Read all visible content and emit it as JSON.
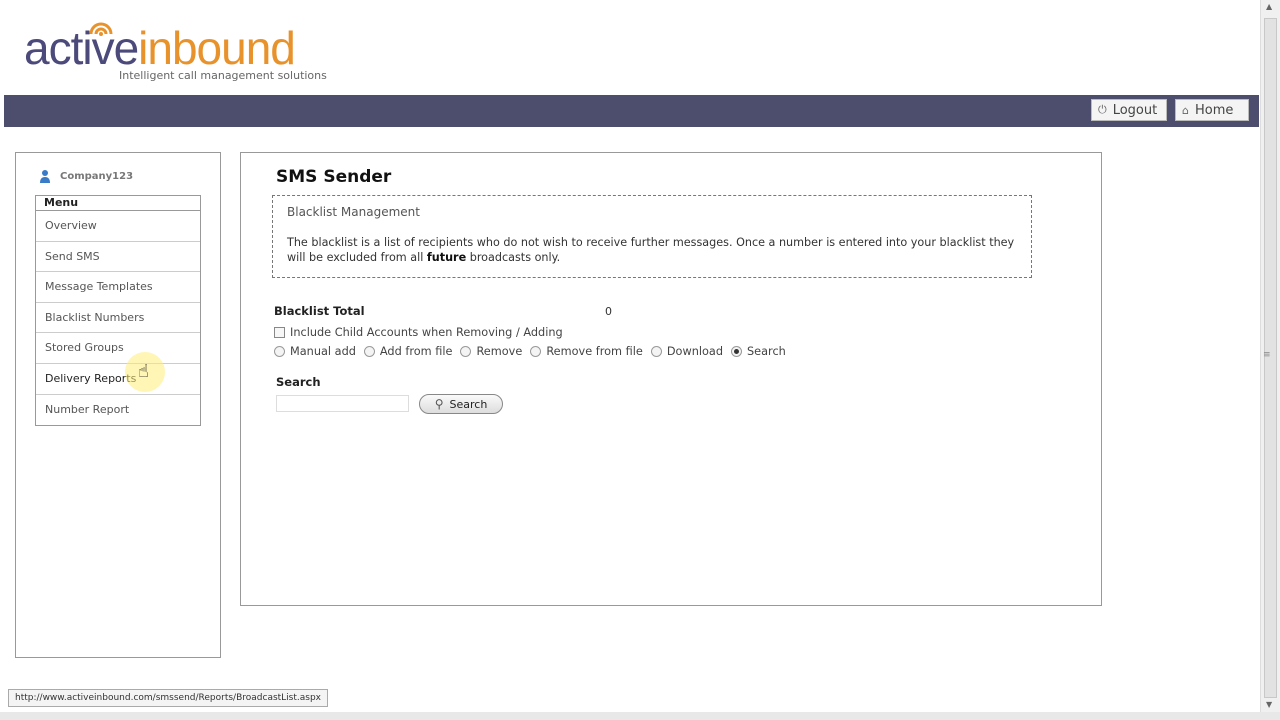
{
  "brand": {
    "name_part1": "active",
    "name_part2": "inbound",
    "tagline": "Intelligent call management solutions"
  },
  "topbar": {
    "logout_label": "Logout",
    "home_label": "Home"
  },
  "sidebar": {
    "username": "Company123",
    "menu_title": "Menu",
    "items": [
      {
        "label": "Overview"
      },
      {
        "label": "Send SMS"
      },
      {
        "label": "Message Templates"
      },
      {
        "label": "Blacklist Numbers"
      },
      {
        "label": "Stored Groups"
      },
      {
        "label": "Delivery Reports"
      },
      {
        "label": "Number Report"
      }
    ]
  },
  "main": {
    "title": "SMS Sender",
    "info": {
      "title": "Blacklist Management",
      "text_before": "The blacklist is a list of recipients who do not wish to receive further messages. Once a number is entered into your blacklist they will be excluded from all ",
      "text_bold": "future",
      "text_after": " broadcasts only."
    },
    "blacklist_total_label": "Blacklist Total",
    "blacklist_total_value": "0",
    "include_child_label": "Include Child Accounts when Removing / Adding",
    "include_child_checked": false,
    "modes": [
      {
        "label": "Manual add",
        "selected": false
      },
      {
        "label": "Add from file",
        "selected": false
      },
      {
        "label": "Remove",
        "selected": false
      },
      {
        "label": "Remove from file",
        "selected": false
      },
      {
        "label": "Download",
        "selected": false
      },
      {
        "label": "Search",
        "selected": true
      }
    ],
    "search_label": "Search",
    "search_value": "",
    "search_button_label": "Search"
  },
  "status_bar": {
    "url": "http://www.activeinbound.com/smssend/Reports/BroadcastList.aspx"
  },
  "colors": {
    "topbar": "#4d4e6e",
    "brand_purple": "#4c4a7a",
    "brand_orange": "#e8922c"
  }
}
